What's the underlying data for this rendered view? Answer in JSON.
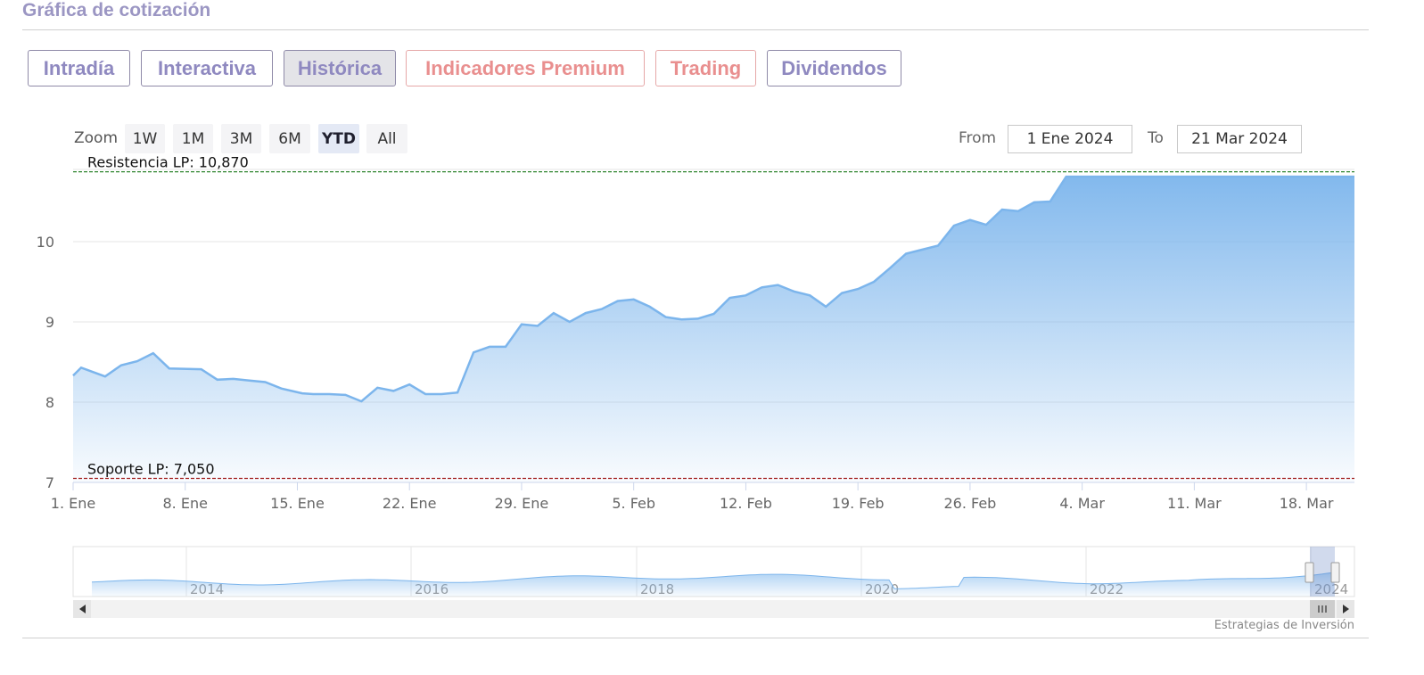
{
  "section_title": "Gráfica de cotización",
  "tabs": [
    {
      "label": "Intradía",
      "active": false,
      "premium": false
    },
    {
      "label": "Interactiva",
      "active": false,
      "premium": false
    },
    {
      "label": "Histórica",
      "active": true,
      "premium": false
    },
    {
      "label": "Indicadores Premium",
      "active": false,
      "premium": true
    },
    {
      "label": "Trading",
      "active": false,
      "premium": true
    },
    {
      "label": "Dividendos",
      "active": false,
      "premium": false
    }
  ],
  "zoom": {
    "label": "Zoom",
    "buttons": [
      "1W",
      "1M",
      "3M",
      "6M",
      "YTD",
      "All"
    ],
    "active": "YTD"
  },
  "range": {
    "from_label": "From",
    "from_value": "1 Ene 2024",
    "to_label": "To",
    "to_value": "21 Mar 2024"
  },
  "colors": {
    "accent": "#7cb5ec",
    "resistance": "#1a7a1a",
    "support": "#a01818",
    "tab_text": "#8f89c0",
    "premium_text": "#e98f8f"
  },
  "chart_data": {
    "type": "area",
    "ylim": [
      7,
      10.9
    ],
    "yticks": [
      7,
      8,
      9,
      10
    ],
    "ytick_labels": [
      "7",
      "8",
      "9",
      "10"
    ],
    "xticks": [
      {
        "label": "1. Ene",
        "x": 0
      },
      {
        "label": "8. Ene",
        "x": 7
      },
      {
        "label": "15. Ene",
        "x": 14
      },
      {
        "label": "22. Ene",
        "x": 21
      },
      {
        "label": "29. Ene",
        "x": 28
      },
      {
        "label": "5. Feb",
        "x": 35
      },
      {
        "label": "12. Feb",
        "x": 42
      },
      {
        "label": "19. Feb",
        "x": 49
      },
      {
        "label": "26. Feb",
        "x": 56
      },
      {
        "label": "4. Mar",
        "x": 63
      },
      {
        "label": "11. Mar",
        "x": 70
      },
      {
        "label": "18. Mar",
        "x": 77
      }
    ],
    "series": [
      {
        "x": [
          0,
          0.5,
          2,
          3,
          4,
          5,
          6,
          8,
          9,
          10,
          11,
          12,
          13,
          14.3,
          15,
          16,
          17,
          18,
          19,
          20,
          21,
          22,
          23,
          24,
          25,
          26,
          27,
          28,
          29,
          30,
          31,
          32,
          33,
          34,
          35,
          36,
          37,
          38,
          39,
          40,
          41,
          42,
          43,
          44,
          45,
          46,
          47,
          48,
          49,
          50,
          51,
          52,
          53,
          54,
          55,
          56,
          57,
          58,
          59,
          60,
          61,
          62,
          63,
          64,
          65,
          66,
          67,
          68,
          69,
          70,
          71,
          72,
          73,
          74,
          75,
          76,
          77,
          78,
          79,
          80
        ],
        "values": [
          8.33,
          8.43,
          8.32,
          8.46,
          8.51,
          8.61,
          8.42,
          8.41,
          8.28,
          8.29,
          8.27,
          8.25,
          8.17,
          8.11,
          8.1,
          8.1,
          8.09,
          8.01,
          8.18,
          8.14,
          8.22,
          8.1,
          8.1,
          8.12,
          8.62,
          8.69,
          8.69,
          8.97,
          8.95,
          9.11,
          9.0,
          9.11,
          9.16,
          9.26,
          9.28,
          9.19,
          9.06,
          9.03,
          9.04,
          9.1,
          9.3,
          9.33,
          9.43,
          9.46,
          9.38,
          9.33,
          9.19,
          9.36,
          9.41,
          9.5,
          9.67,
          9.85,
          9.9,
          9.95,
          10.2,
          10.27,
          10.21,
          10.4,
          10.38,
          10.49,
          10.5,
          10.81,
          10.81,
          10.81,
          10.81,
          10.81,
          10.81,
          10.81,
          10.81,
          10.81,
          10.81,
          10.81,
          10.81,
          10.81,
          10.81,
          10.81,
          10.81,
          10.81,
          10.81,
          10.81
        ]
      }
    ],
    "plot_x_max": 80,
    "annotations": [
      {
        "label": "Resistencia LP: 10,870",
        "y": 10.87,
        "color": "#1a7a1a"
      },
      {
        "label": "Soporte LP: 7,050",
        "y": 7.05,
        "color": "#a01818"
      }
    ],
    "navigator": {
      "labels": [
        "2014",
        "2016",
        "2018",
        "2020",
        "2022",
        "2024"
      ]
    }
  },
  "credit": "Estrategias de Inversión"
}
